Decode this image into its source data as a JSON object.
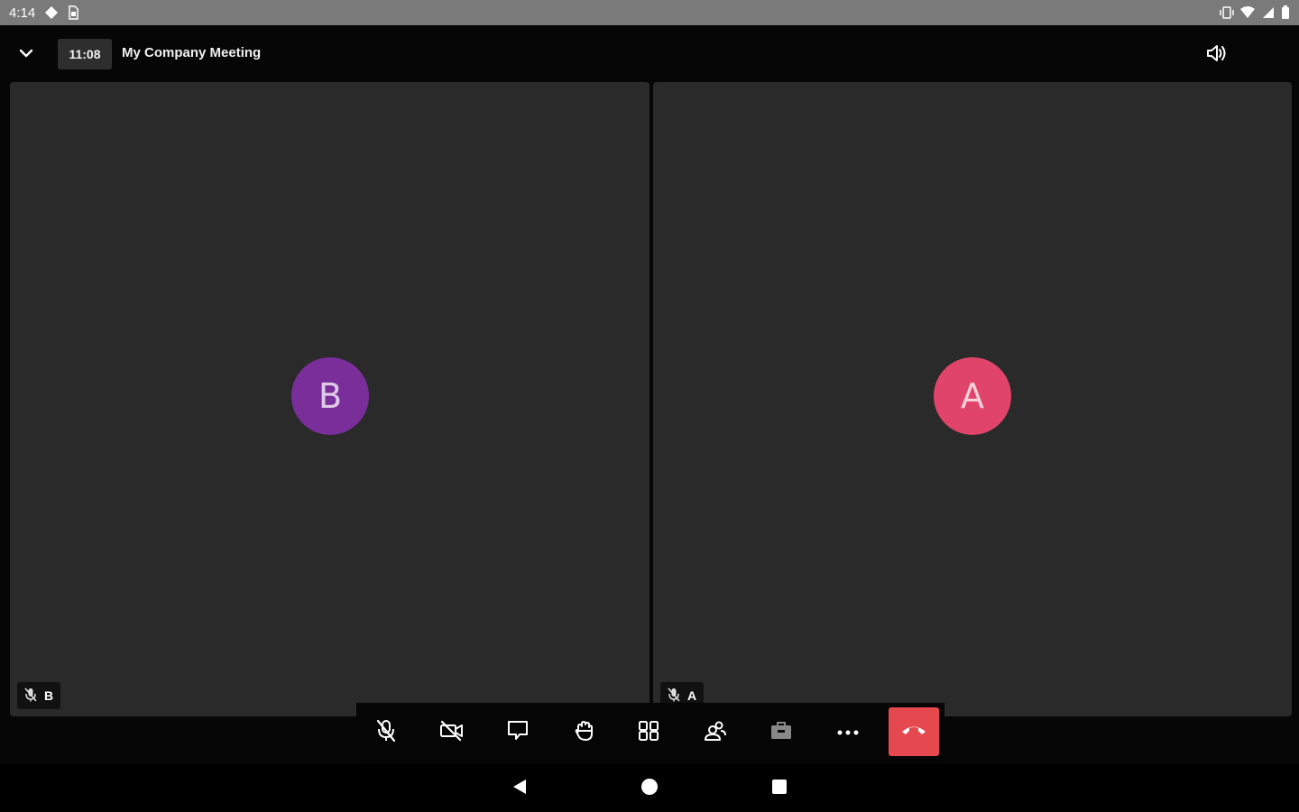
{
  "status_bar": {
    "time": "4:14",
    "icons": [
      "drive-icon",
      "sim-card-icon",
      "vibrate-icon",
      "wifi-icon",
      "signal-icon",
      "battery-icon"
    ]
  },
  "meeting": {
    "elapsed_time": "11:08",
    "title": "My Company Meeting"
  },
  "participants": [
    {
      "initial": "B",
      "name": "B",
      "avatar_color": "#7a2e9a",
      "muted": true
    },
    {
      "initial": "A",
      "name": "A",
      "avatar_color": "#e0446a",
      "muted": true
    }
  ],
  "toolbar": {
    "items": [
      "microphone-muted-icon",
      "camera-off-icon",
      "chat-icon",
      "raise-hand-icon",
      "tile-view-icon",
      "participants-icon",
      "breakout-rooms-icon",
      "more-icon"
    ],
    "hangup_color": "#e5484f"
  },
  "nav_bar": {
    "buttons": [
      "back-icon",
      "home-icon",
      "recents-icon"
    ]
  }
}
